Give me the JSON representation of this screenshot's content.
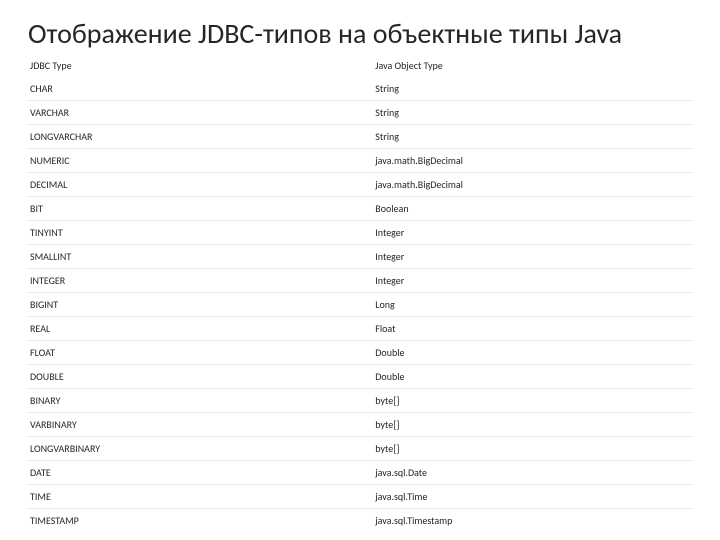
{
  "title": "Отображение JDBC-типов на объектные типы Java",
  "header": {
    "col1": "JDBC Type",
    "col2": "Java Object Type"
  },
  "rows": [
    {
      "col1": "CHAR",
      "col2": "String"
    },
    {
      "col1": "VARCHAR",
      "col2": "String"
    },
    {
      "col1": "LONGVARCHAR",
      "col2": "String"
    },
    {
      "col1": "NUMERIC",
      "col2": "java.math.BigDecimal"
    },
    {
      "col1": "DECIMAL",
      "col2": "java.math.BigDecimal"
    },
    {
      "col1": "BIT",
      "col2": "Boolean"
    },
    {
      "col1": "TINYINT",
      "col2": "Integer"
    },
    {
      "col1": "SMALLINT",
      "col2": "Integer"
    },
    {
      "col1": "INTEGER",
      "col2": "Integer"
    },
    {
      "col1": "BIGINT",
      "col2": "Long"
    },
    {
      "col1": "REAL",
      "col2": "Float"
    },
    {
      "col1": "FLOAT",
      "col2": "Double"
    },
    {
      "col1": "DOUBLE",
      "col2": "Double"
    },
    {
      "col1": "BINARY",
      "col2": "byte[]"
    },
    {
      "col1": "VARBINARY",
      "col2": "byte[]"
    },
    {
      "col1": "LONGVARBINARY",
      "col2": "byte[]"
    },
    {
      "col1": "DATE",
      "col2": "java.sql.Date"
    },
    {
      "col1": "TIME",
      "col2": "java.sql.Time"
    },
    {
      "col1": "TIMESTAMP",
      "col2": "java.sql.Timestamp"
    }
  ]
}
